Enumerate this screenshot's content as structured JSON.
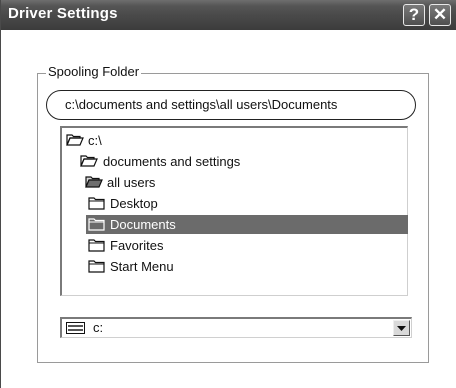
{
  "window": {
    "title": "Driver Settings",
    "help_glyph": "?",
    "close_glyph": "✕"
  },
  "spooling": {
    "group_label": "Spooling Folder",
    "path": "c:\\documents and settings\\all users\\Documents"
  },
  "tree": {
    "items": [
      {
        "label": "c:\\",
        "icon": "open-folder-icon",
        "selected": false
      },
      {
        "label": "documents and settings",
        "icon": "open-folder-icon",
        "selected": false
      },
      {
        "label": "all users",
        "icon": "open-folder-icon",
        "selected": false
      },
      {
        "label": "Desktop",
        "icon": "folder-icon",
        "selected": false
      },
      {
        "label": "Documents",
        "icon": "folder-icon",
        "selected": true
      },
      {
        "label": "Favorites",
        "icon": "folder-icon",
        "selected": false
      },
      {
        "label": "Start Menu",
        "icon": "folder-icon",
        "selected": false
      }
    ]
  },
  "drive": {
    "selected": "c:",
    "icon": "drive-icon"
  },
  "colors": {
    "titlebar": "#4a4a4a",
    "selection": "#6b6b6b"
  }
}
